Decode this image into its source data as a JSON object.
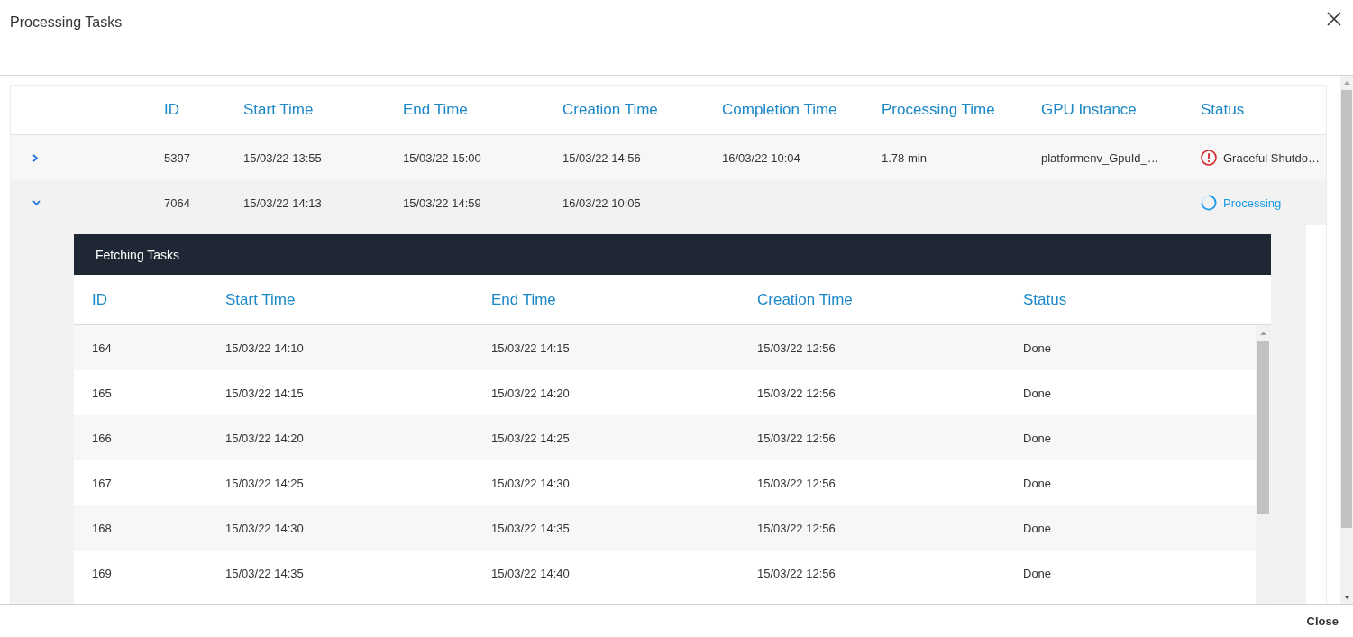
{
  "dialog": {
    "title": "Processing Tasks"
  },
  "table": {
    "columns": [
      "ID",
      "Start Time",
      "End Time",
      "Creation Time",
      "Completion Time",
      "Processing Time",
      "GPU Instance",
      "Status"
    ],
    "rows": [
      {
        "expanded": false,
        "id": "5397",
        "start_time": "15/03/22 13:55",
        "end_time": "15/03/22 15:00",
        "creation_time": "15/03/22 14:56",
        "completion_time": "16/03/22 10:04",
        "processing_time": "1.78 min",
        "gpu_instance": "platformenv_GpuId_…",
        "status": {
          "kind": "error",
          "label": "Graceful Shutdo…"
        }
      },
      {
        "expanded": true,
        "id": "7064",
        "start_time": "15/03/22 14:13",
        "end_time": "15/03/22 14:59",
        "creation_time": "16/03/22 10:05",
        "status": {
          "kind": "processing",
          "label": "Processing"
        },
        "details": {
          "title": "Fetching Tasks",
          "columns": [
            "ID",
            "Start Time",
            "End Time",
            "Creation Time",
            "Status"
          ],
          "rows": [
            {
              "id": "164",
              "start_time": "15/03/22 14:10",
              "end_time": "15/03/22 14:15",
              "creation_time": "15/03/22 12:56",
              "status": "Done"
            },
            {
              "id": "165",
              "start_time": "15/03/22 14:15",
              "end_time": "15/03/22 14:20",
              "creation_time": "15/03/22 12:56",
              "status": "Done"
            },
            {
              "id": "166",
              "start_time": "15/03/22 14:20",
              "end_time": "15/03/22 14:25",
              "creation_time": "15/03/22 12:56",
              "status": "Done"
            },
            {
              "id": "167",
              "start_time": "15/03/22 14:25",
              "end_time": "15/03/22 14:30",
              "creation_time": "15/03/22 12:56",
              "status": "Done"
            },
            {
              "id": "168",
              "start_time": "15/03/22 14:30",
              "end_time": "15/03/22 14:35",
              "creation_time": "15/03/22 12:56",
              "status": "Done"
            },
            {
              "id": "169",
              "start_time": "15/03/22 14:35",
              "end_time": "15/03/22 14:40",
              "creation_time": "15/03/22 12:56",
              "status": "Done"
            }
          ]
        }
      }
    ]
  },
  "footer": {
    "buttons": [
      "Close"
    ]
  }
}
